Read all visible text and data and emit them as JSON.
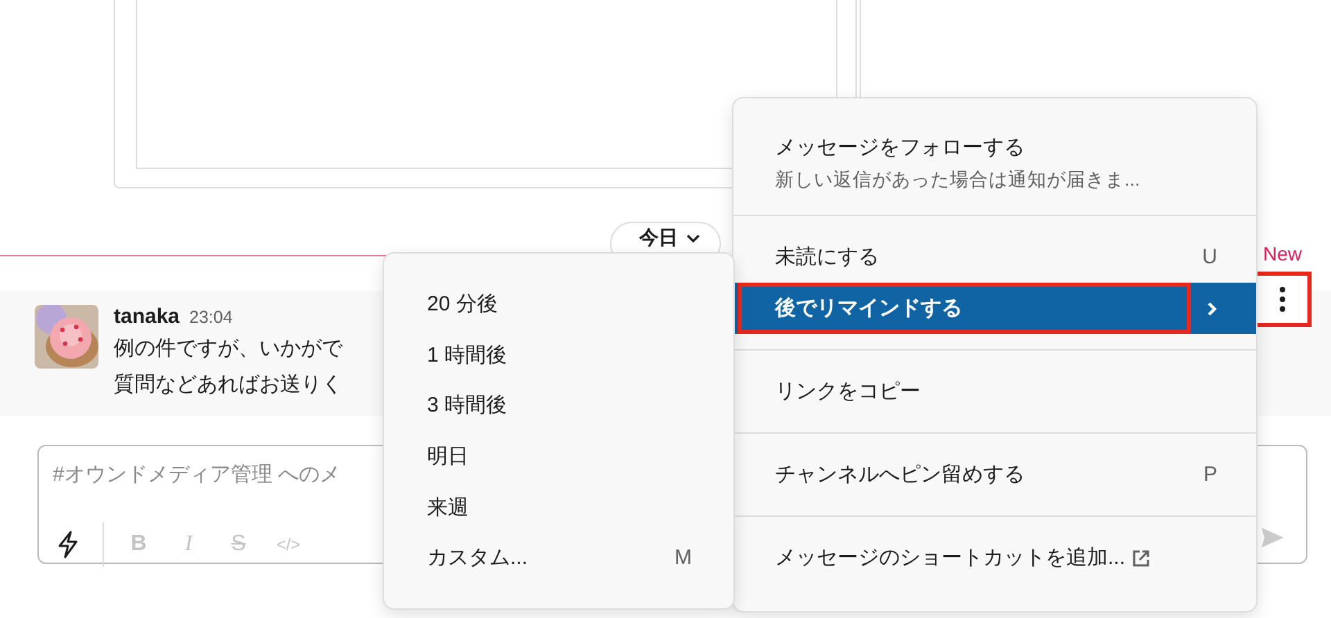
{
  "date_divider": {
    "label": "今日"
  },
  "message": {
    "author": "tanaka",
    "time": "23:04",
    "lines": [
      "例の件ですが、いかがで",
      "質問などあればお送りく"
    ]
  },
  "composer": {
    "placeholder": "#オウンドメディア管理 へのメ",
    "toolbar": [
      {
        "kind": "shortcut"
      },
      {
        "kind": "bold",
        "glyph": "B"
      },
      {
        "kind": "italic",
        "glyph": "I"
      },
      {
        "kind": "strike",
        "glyph": "S"
      },
      {
        "kind": "code",
        "glyph": "</>"
      }
    ]
  },
  "more_button": {
    "badge": "New",
    "highlighted": true
  },
  "context_menu": {
    "sections": [
      [
        {
          "label": "メッセージをフォローする",
          "subtitle": "新しい返信があった場合は通知が届きま...",
          "selected": false
        }
      ],
      [
        {
          "label": "未読にする",
          "shortcut": "U",
          "selected": false
        },
        {
          "label": "後でリマインドする",
          "has_submenu": true,
          "selected": true
        }
      ],
      [
        {
          "label": "リンクをコピー",
          "selected": false
        }
      ],
      [
        {
          "label": "チャンネルへピン留めする",
          "shortcut": "P",
          "selected": false
        }
      ],
      [
        {
          "label": "メッセージのショートカットを追加...",
          "external": true,
          "selected": false
        }
      ]
    ]
  },
  "reminder_submenu": {
    "items": [
      {
        "label": "20 分後"
      },
      {
        "label": "1 時間後"
      },
      {
        "label": "3 時間後"
      },
      {
        "label": "明日"
      },
      {
        "label": "来週"
      },
      {
        "label": "カスタム...",
        "shortcut": "M"
      }
    ]
  }
}
